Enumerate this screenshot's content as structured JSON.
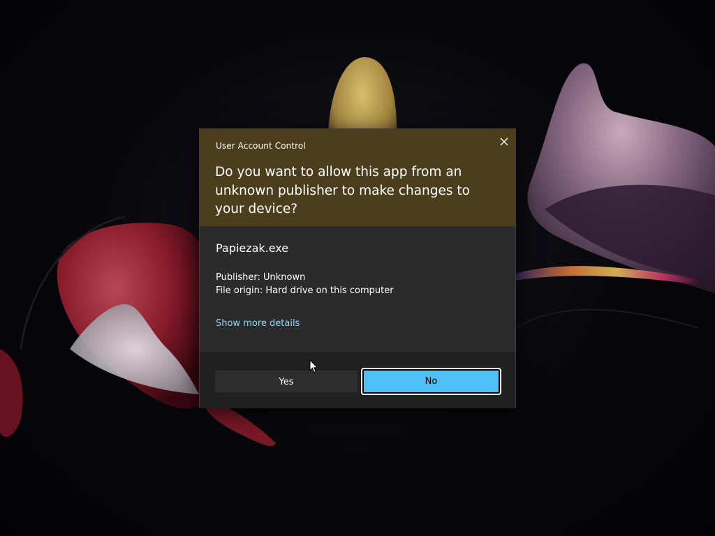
{
  "dialog": {
    "caption": "User Account Control",
    "question": "Do you want to allow this app from an unknown publisher to make changes to your device?",
    "app_name": "Papiezak.exe",
    "publisher": "Publisher: Unknown",
    "file_origin": "File origin: Hard drive on this computer",
    "more_details_link": "Show more details",
    "yes_label": "Yes",
    "no_label": "No",
    "close_icon": "close-icon"
  },
  "colors": {
    "header_background": "#4c3d1c",
    "body_background": "#2b2b2b",
    "footer_background": "#202020",
    "link": "#8fd8f5",
    "primary_button": "#4fc0f5"
  }
}
